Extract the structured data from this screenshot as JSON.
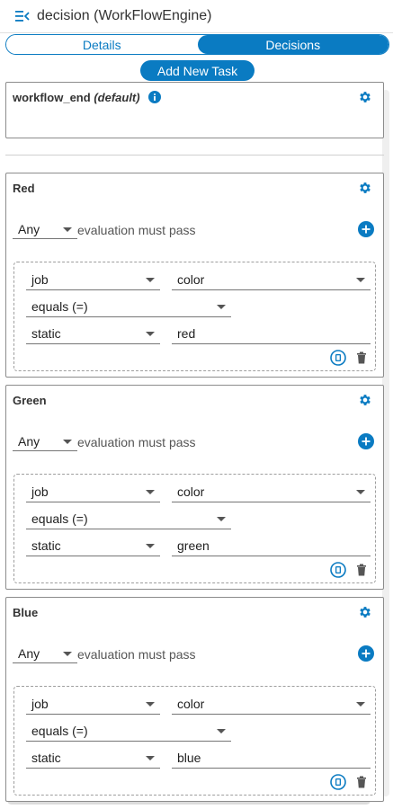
{
  "header": {
    "title": "decision (WorkFlowEngine)"
  },
  "tabs": [
    {
      "label": "Details",
      "active": false
    },
    {
      "label": "Decisions",
      "active": true
    }
  ],
  "add_task_label": "Add New Task",
  "default_card": {
    "name": "workflow_end",
    "default_label": "(default)"
  },
  "decision_cards": [
    {
      "name": "Red",
      "match_mode": "Any",
      "match_text": "evaluation must pass",
      "condition": {
        "source": "job",
        "field": "color",
        "operator": "equals (=)",
        "value_type": "static",
        "value": "red"
      }
    },
    {
      "name": "Green",
      "match_mode": "Any",
      "match_text": "evaluation must pass",
      "condition": {
        "source": "job",
        "field": "color",
        "operator": "equals (=)",
        "value_type": "static",
        "value": "green"
      }
    },
    {
      "name": "Blue",
      "match_mode": "Any",
      "match_text": "evaluation must pass",
      "condition": {
        "source": "job",
        "field": "color",
        "operator": "equals (=)",
        "value_type": "static",
        "value": "blue"
      }
    }
  ],
  "colors": {
    "accent": "#0a7bc2",
    "border": "#8c8c8c"
  }
}
